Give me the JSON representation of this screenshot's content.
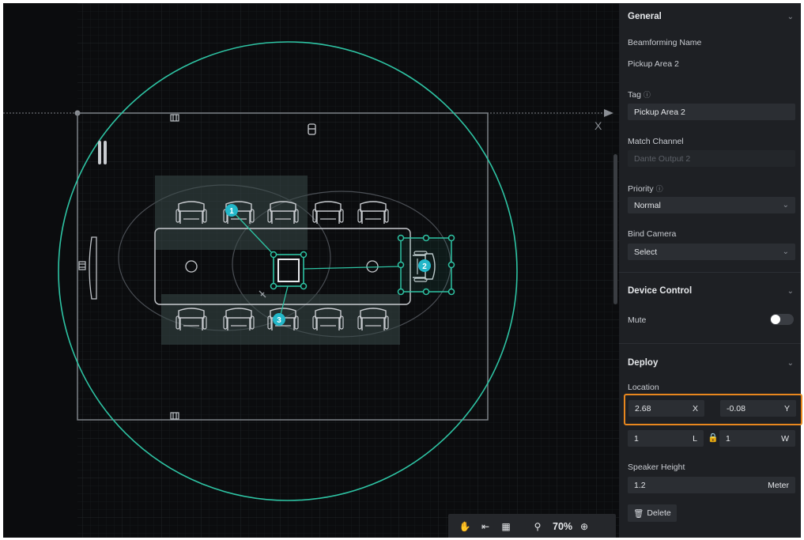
{
  "canvas": {
    "axis_x_label": "X",
    "pickup_areas": [
      "1",
      "2",
      "3"
    ]
  },
  "toolbar": {
    "zoom_level": "70%"
  },
  "panel": {
    "general": {
      "title": "General",
      "beamforming_name_label": "Beamforming Name",
      "beamforming_name_value": "Pickup Area 2",
      "tag_label": "Tag",
      "tag_value": "Pickup Area 2",
      "match_channel_label": "Match Channel",
      "match_channel_value": "Dante Output 2",
      "priority_label": "Priority",
      "priority_value": "Normal",
      "bind_camera_label": "Bind Camera",
      "bind_camera_value": "Select"
    },
    "device_control": {
      "title": "Device Control",
      "mute_label": "Mute",
      "mute_on": false
    },
    "deploy": {
      "title": "Deploy",
      "location_label": "Location",
      "x_value": "2.68",
      "x_unit": "X",
      "y_value": "-0.08",
      "y_unit": "Y",
      "l_value": "1",
      "l_unit": "L",
      "w_value": "1",
      "w_unit": "W",
      "speaker_height_label": "Speaker Height",
      "speaker_height_value": "1.2",
      "speaker_height_unit": "Meter",
      "delete_label": "Delete"
    }
  },
  "colors": {
    "accent": "#2ec4a4",
    "highlight": "#e8871e",
    "panel_bg": "#1e2024",
    "canvas_bg": "#0b0c0e"
  }
}
